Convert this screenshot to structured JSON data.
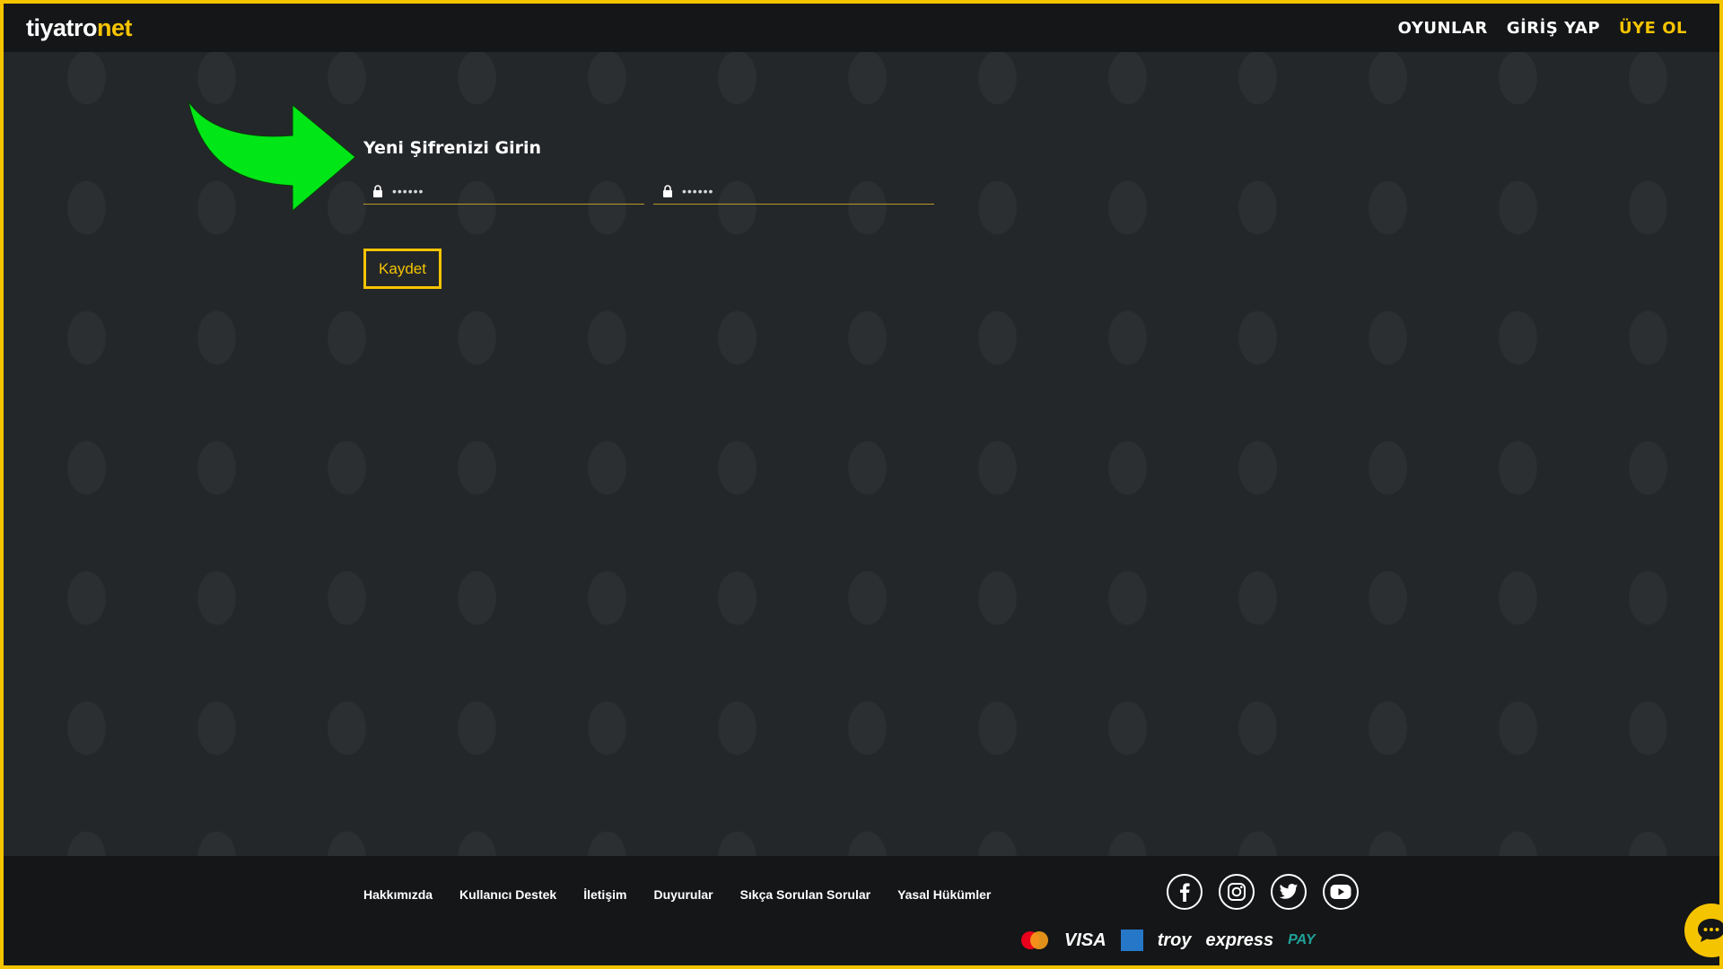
{
  "header": {
    "logo_main": "tiyatro",
    "logo_accent": "net",
    "nav": {
      "plays": "OYUNLAR",
      "login": "GİRİŞ YAP",
      "signup": "ÜYE OL"
    }
  },
  "form": {
    "title": "Yeni Şifrenizi Girin",
    "password_value": "••••••",
    "password_confirm_value": "••••••",
    "save_label": "Kaydet"
  },
  "footer": {
    "links": {
      "about": "Hakkımızda",
      "support": "Kullanıcı Destek",
      "contact": "İletişim",
      "announcements": "Duyurular",
      "faq": "Sıkça Sorulan Sorular",
      "legal": "Yasal Hükümler"
    },
    "social_icons": [
      "facebook-icon",
      "instagram-icon",
      "twitter-icon",
      "youtube-icon"
    ],
    "payments": {
      "visa": "VISA",
      "troy": "troy",
      "express": "express",
      "paypass": "PAY"
    }
  },
  "colors": {
    "accent": "#f5c400",
    "background": "#24272a",
    "bar": "#151617",
    "arrow": "#00e617"
  }
}
